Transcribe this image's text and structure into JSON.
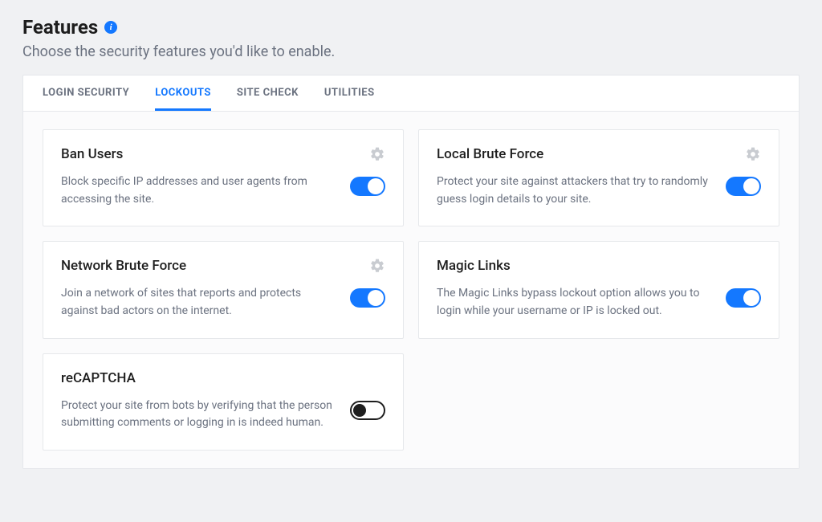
{
  "header": {
    "title": "Features",
    "subtitle": "Choose the security features you'd like to enable."
  },
  "tabs": [
    {
      "label": "LOGIN SECURITY",
      "active": false
    },
    {
      "label": "LOCKOUTS",
      "active": true
    },
    {
      "label": "SITE CHECK",
      "active": false
    },
    {
      "label": "UTILITIES",
      "active": false
    }
  ],
  "cards": [
    {
      "title": "Ban Users",
      "desc": "Block specific IP addresses and user agents from accessing the site.",
      "has_settings": true,
      "toggle_on": true
    },
    {
      "title": "Local Brute Force",
      "desc": "Protect your site against attackers that try to randomly guess login details to your site.",
      "has_settings": true,
      "toggle_on": true
    },
    {
      "title": "Network Brute Force",
      "desc": "Join a network of sites that reports and protects against bad actors on the internet.",
      "has_settings": true,
      "toggle_on": true
    },
    {
      "title": "Magic Links",
      "desc": "The Magic Links bypass lockout option allows you to login while your username or IP is locked out.",
      "has_settings": false,
      "toggle_on": true
    },
    {
      "title": "reCAPTCHA",
      "desc": "Protect your site from bots by verifying that the person submitting comments or logging in is indeed human.",
      "has_settings": false,
      "toggle_on": false
    }
  ]
}
